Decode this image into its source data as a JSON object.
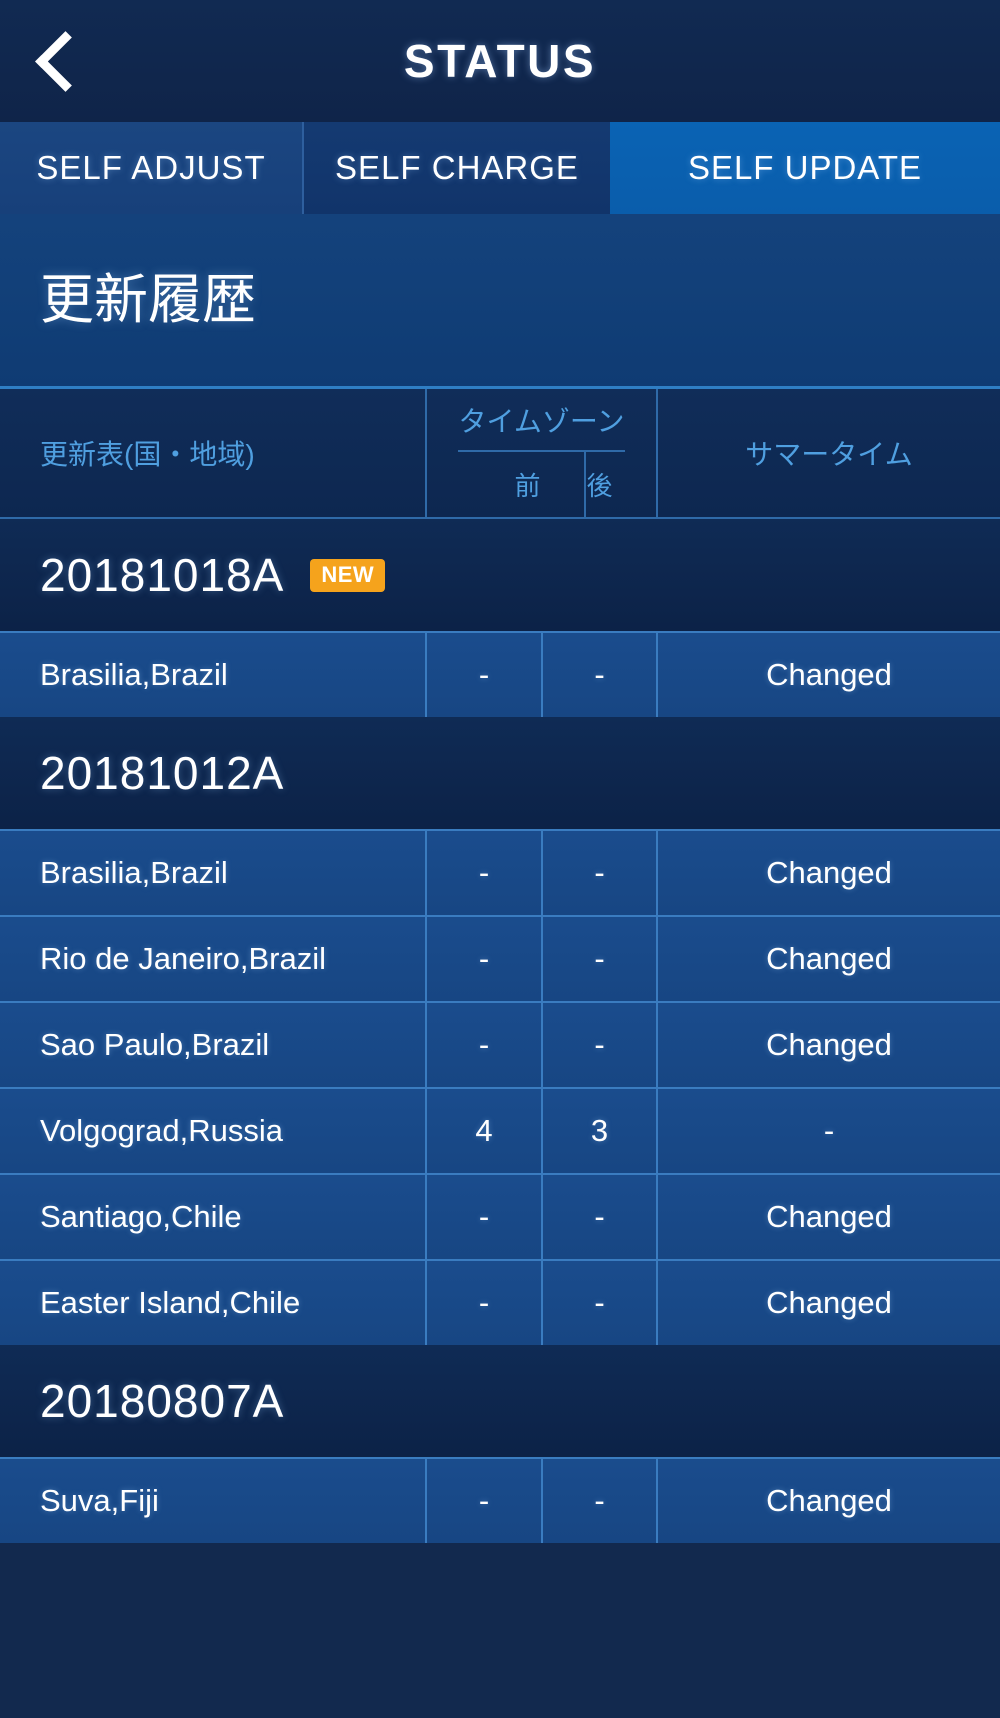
{
  "topbar": {
    "back_icon": "chevron-left-icon",
    "title": "STATUS"
  },
  "tabs": [
    {
      "label": "SELF ADJUST",
      "active": false
    },
    {
      "label": "SELF CHARGE",
      "active": false
    },
    {
      "label": "SELF UPDATE",
      "active": true
    }
  ],
  "page": {
    "heading": "更新履歴"
  },
  "table": {
    "headers": {
      "location": "更新表(国・地域)",
      "timezone_group": "タイムゾーン",
      "timezone_before": "前",
      "timezone_after": "後",
      "dst": "サマータイム"
    },
    "groups": [
      {
        "version": "20181018A",
        "badge": "NEW",
        "rows": [
          {
            "location": "Brasilia,Brazil",
            "tz_before": "-",
            "tz_after": "-",
            "dst": "Changed"
          }
        ]
      },
      {
        "version": "20181012A",
        "badge": "",
        "rows": [
          {
            "location": "Brasilia,Brazil",
            "tz_before": "-",
            "tz_after": "-",
            "dst": "Changed"
          },
          {
            "location": "Rio de Janeiro,Brazil",
            "tz_before": "-",
            "tz_after": "-",
            "dst": "Changed"
          },
          {
            "location": "Sao Paulo,Brazil",
            "tz_before": "-",
            "tz_after": "-",
            "dst": "Changed"
          },
          {
            "location": "Volgograd,Russia",
            "tz_before": "4",
            "tz_after": "3",
            "dst": "-"
          },
          {
            "location": "Santiago,Chile",
            "tz_before": "-",
            "tz_after": "-",
            "dst": "Changed"
          },
          {
            "location": "Easter Island,Chile",
            "tz_before": "-",
            "tz_after": "-",
            "dst": "Changed"
          }
        ]
      },
      {
        "version": "20180807A",
        "badge": "",
        "rows": [
          {
            "location": "Suva,Fiji",
            "tz_before": "-",
            "tz_after": "-",
            "dst": "Changed"
          }
        ]
      }
    ]
  },
  "colors": {
    "accent_tab_active": "#0a5dab",
    "badge_new": "#f5a31c",
    "header_text": "#4f9fe0",
    "row_bg": "#174683",
    "page_bg": "#12294e"
  }
}
